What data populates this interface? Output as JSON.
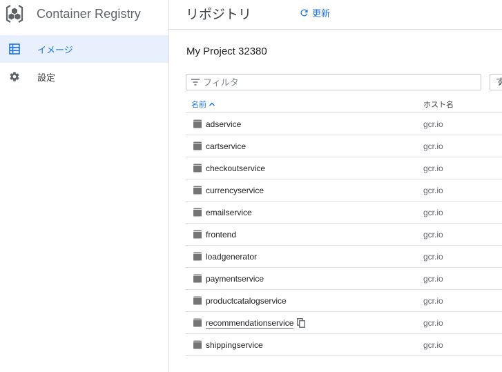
{
  "sidebar": {
    "app_title": "Container Registry",
    "items": [
      {
        "label": "イメージ",
        "icon": "grid-list-icon",
        "active": true
      },
      {
        "label": "設定",
        "icon": "gear-icon",
        "active": false
      }
    ]
  },
  "topbar": {
    "title": "リポジトリ",
    "refresh_label": "更新"
  },
  "main": {
    "project_title": "My Project 32380",
    "filter_placeholder": "フィルタ",
    "extra_button_label": "す",
    "table": {
      "columns": {
        "name": "名前",
        "host": "ホスト名"
      },
      "rows": [
        {
          "name": "adservice",
          "host": "gcr.io"
        },
        {
          "name": "cartservice",
          "host": "gcr.io"
        },
        {
          "name": "checkoutservice",
          "host": "gcr.io"
        },
        {
          "name": "currencyservice",
          "host": "gcr.io"
        },
        {
          "name": "emailservice",
          "host": "gcr.io"
        },
        {
          "name": "frontend",
          "host": "gcr.io"
        },
        {
          "name": "loadgenerator",
          "host": "gcr.io"
        },
        {
          "name": "paymentservice",
          "host": "gcr.io"
        },
        {
          "name": "productcatalogservice",
          "host": "gcr.io"
        },
        {
          "name": "recommendationservice",
          "host": "gcr.io",
          "hovered": true
        },
        {
          "name": "shippingservice",
          "host": "gcr.io"
        }
      ]
    }
  },
  "colors": {
    "accent": "#1a73e8",
    "active_bg": "#e8f0fe",
    "icon_gray": "#757575"
  }
}
